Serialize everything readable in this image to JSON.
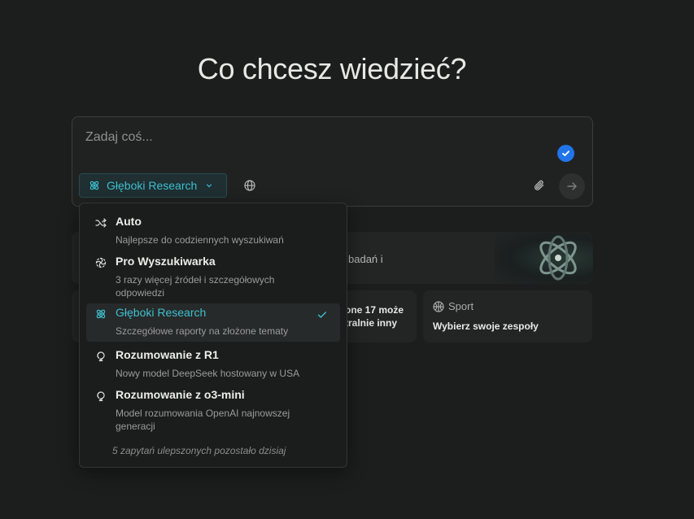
{
  "heading": "Co chcesz wiedzieć?",
  "composer": {
    "placeholder": "Zadaj coś...",
    "mode_label": "Głęboki Research"
  },
  "cards": {
    "wide_text": "badań i",
    "left_text": "one 17 może\ntralnie inny",
    "sport_label": "Sport",
    "sport_title": "Wybierz swoje zespoły"
  },
  "dropdown": {
    "options": [
      {
        "title": "Auto",
        "desc": "Najlepsze do codziennych wyszukiwań",
        "icon": "shuffle-icon"
      },
      {
        "title": "Pro Wyszukiwarka",
        "desc": "3 razy więcej źródeł i szczegółowych odpowiedzi",
        "icon": "pro-search-icon"
      },
      {
        "title": "Głęboki Research",
        "desc": "Szczegółowe raporty na złożone tematy",
        "icon": "atom-icon",
        "selected": true
      },
      {
        "title": "Rozumowanie z R1",
        "desc": "Nowy model DeepSeek hostowany w USA",
        "icon": "lightbulb-icon"
      },
      {
        "title": "Rozumowanie z o3-mini",
        "desc": "Model rozumowania OpenAI najnowszej generacji",
        "icon": "lightbulb-icon"
      }
    ],
    "footer": "5 zapytań ulepszonych pozostało dzisiaj"
  },
  "colors": {
    "background": "#1c1d1d",
    "accent": "#3fbfcf",
    "check_badge": "#2175e9"
  }
}
